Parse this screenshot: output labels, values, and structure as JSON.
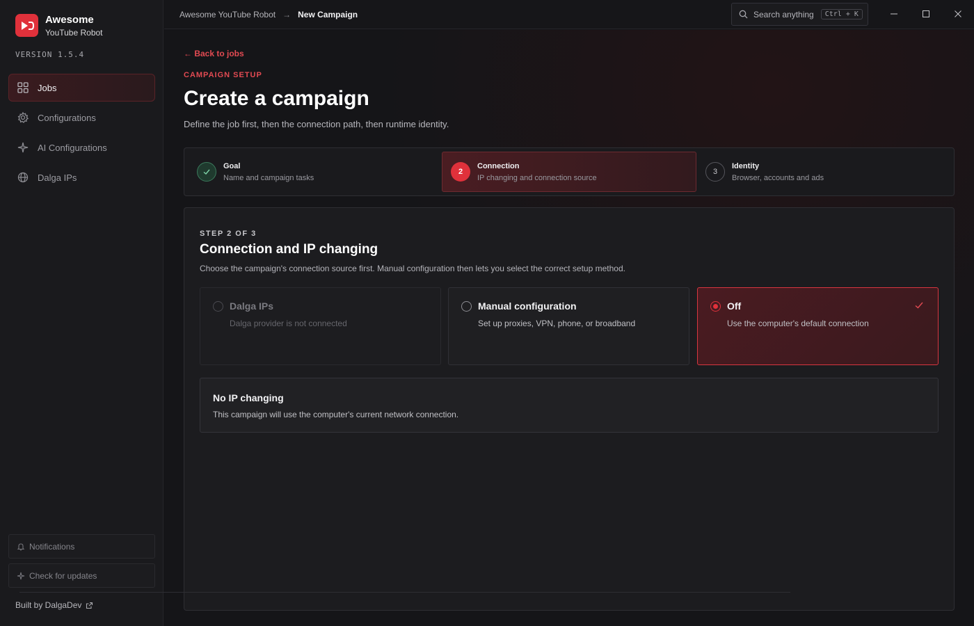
{
  "brand": {
    "name": "Awesome",
    "sub": "YouTube Robot",
    "version": "VERSION 1.5.4"
  },
  "sidebar": {
    "items": [
      {
        "label": "Jobs",
        "icon": "grid-icon",
        "active": true
      },
      {
        "label": "Configurations",
        "icon": "gear-icon"
      },
      {
        "label": "AI Configurations",
        "icon": "sparkle-icon"
      },
      {
        "label": "Dalga IPs",
        "icon": "globe-icon"
      }
    ],
    "notifications": "Notifications",
    "updates": "Check for updates",
    "built_by": "Built by DalgaDev"
  },
  "topbar": {
    "crumb_root": "Awesome YouTube Robot",
    "crumb_current": "New Campaign",
    "search_placeholder": "Search anything",
    "search_shortcut": "Ctrl + K"
  },
  "main": {
    "back": "← Back to jobs",
    "eyebrow": "CAMPAIGN SETUP",
    "title": "Create a campaign",
    "subtitle": "Define the job first, then the connection path, then runtime identity."
  },
  "steps": [
    {
      "number": "1",
      "title": "Goal",
      "desc": "Name and campaign tasks",
      "state": "done"
    },
    {
      "number": "2",
      "title": "Connection",
      "desc": "IP changing and connection source",
      "state": "active"
    },
    {
      "number": "3",
      "title": "Identity",
      "desc": "Browser, accounts and ads",
      "state": "idle"
    }
  ],
  "panel": {
    "eyebrow": "STEP 2 OF 3",
    "title": "Connection and IP changing",
    "desc": "Choose the campaign's connection source first. Manual configuration then lets you select the correct setup method.",
    "options": [
      {
        "title": "Dalga IPs",
        "desc": "Dalga provider is not connected",
        "state": "disabled"
      },
      {
        "title": "Manual configuration",
        "desc": "Set up proxies, VPN, phone, or broadband",
        "state": "default"
      },
      {
        "title": "Off",
        "desc": "Use the computer's default connection",
        "state": "selected"
      }
    ],
    "info_title": "No IP changing",
    "info_desc": "This campaign will use the computer's current network connection."
  },
  "colors": {
    "accent": "#e0313b",
    "accent_text": "#e24a52",
    "success": "#3b7a5c"
  }
}
